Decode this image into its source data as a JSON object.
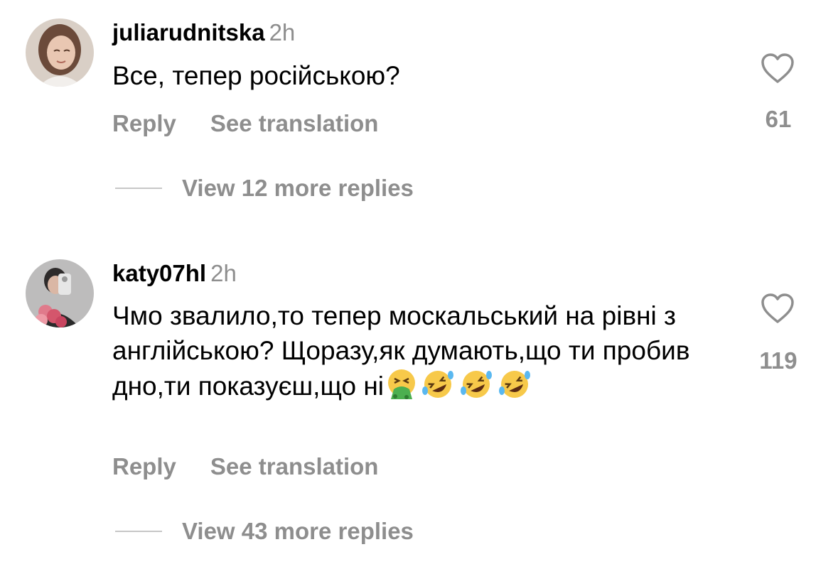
{
  "comments": [
    {
      "username": "juliarudnitska",
      "time": "2h",
      "text": "Все, тепер російською?",
      "reply_label": "Reply",
      "translate_label": "See translation",
      "likes": "61",
      "view_replies": "View 12 more replies"
    },
    {
      "username": "katy07hl",
      "time": "2h",
      "text": "Чмо звалило,то тепер москальський на рівні з англійською? Щоразу,як думають,що ти пробив дно,ти показуєш,що ні",
      "emojis": [
        "vomiting-face",
        "rolling-on-floor-laughing",
        "rolling-on-floor-laughing",
        "rolling-on-floor-laughing"
      ],
      "reply_label": "Reply",
      "translate_label": "See translation",
      "likes": "119",
      "view_replies": "View 43 more replies"
    }
  ],
  "colors": {
    "secondary_text": "#8e8e8e",
    "primary_text": "#000000",
    "divider": "#c7c7c7"
  }
}
